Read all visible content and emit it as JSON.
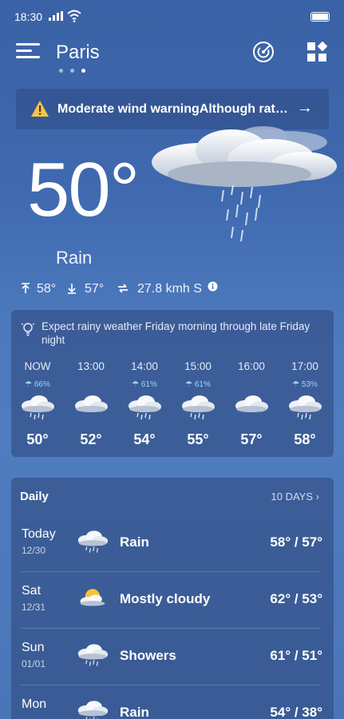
{
  "status_bar": {
    "time": "18:30"
  },
  "header": {
    "city": "Paris"
  },
  "alert": {
    "text": "Moderate wind warningAlthough rat…"
  },
  "current": {
    "temperature": "50°",
    "condition": "Rain",
    "high": "58°",
    "low": "57°",
    "wind": "27.8 kmh S"
  },
  "hourly": {
    "summary": "Expect rainy weather Friday morning through late Friday night",
    "items": [
      {
        "time": "NOW",
        "precip": "66%",
        "temp": "50°",
        "icon": "rain-cloud-icon"
      },
      {
        "time": "13:00",
        "precip": "",
        "temp": "52°",
        "icon": "cloud-icon"
      },
      {
        "time": "14:00",
        "precip": "61%",
        "temp": "54°",
        "icon": "rain-cloud-icon"
      },
      {
        "time": "15:00",
        "precip": "61%",
        "temp": "55°",
        "icon": "rain-cloud-icon"
      },
      {
        "time": "16:00",
        "precip": "",
        "temp": "57°",
        "icon": "cloud-icon"
      },
      {
        "time": "17:00",
        "precip": "53%",
        "temp": "58°",
        "icon": "rain-cloud-icon"
      }
    ]
  },
  "daily": {
    "title": "Daily",
    "more_label": "10 DAYS",
    "days": [
      {
        "name": "Today",
        "date": "12/30",
        "condition": "Rain",
        "temps": "58° / 57°",
        "icon": "rain-cloud-icon"
      },
      {
        "name": "Sat",
        "date": "12/31",
        "condition": "Mostly cloudy",
        "temps": "62° / 53°",
        "icon": "sun-cloud-icon"
      },
      {
        "name": "Sun",
        "date": "01/01",
        "condition": "Showers",
        "temps": "61° / 51°",
        "icon": "rain-cloud-icon"
      },
      {
        "name": "Mon",
        "date": "",
        "condition": "Rain",
        "temps": "54° / 38°",
        "icon": "rain-cloud-icon"
      }
    ]
  },
  "colors": {
    "background_top": "#3a62a6",
    "background_bottom": "#4f7cbf",
    "warning": "#f6c445",
    "precip": "#9fd6ff"
  }
}
